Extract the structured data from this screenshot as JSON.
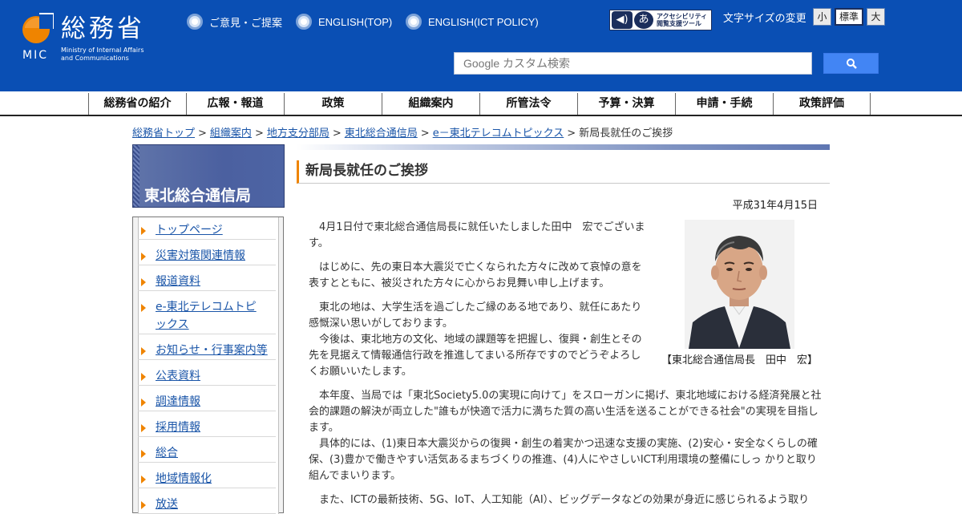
{
  "header": {
    "logo_text": "総務省",
    "logo_abbr": "MIC",
    "logo_en_line1": "Ministry of Internal Affairs",
    "logo_en_line2": "and Communications",
    "links": [
      "ご意見・ご提案",
      "ENGLISH(TOP)",
      "ENGLISH(ICT POLICY)"
    ],
    "a11y_tool_line1": "アクセシビリティ",
    "a11y_tool_line2": "閲覧支援ツール",
    "a11y_icon_char": "あ",
    "font_size_label": "文字サイズの変更",
    "font_size_options": [
      "小",
      "標準",
      "大"
    ],
    "search_placeholder": "Google カスタム検索"
  },
  "nav": [
    "総務省の紹介",
    "広報・報道",
    "政策",
    "組織案内",
    "所管法令",
    "予算・決算",
    "申請・手続",
    "政策評価"
  ],
  "breadcrumb": {
    "links": [
      "総務省トップ",
      "組織案内",
      "地方支分部局",
      "東北総合通信局",
      "e－東北テレコムトピックス"
    ],
    "current": "新局長就任のご挨拶",
    "sep": ">"
  },
  "sidebar": {
    "title": "東北総合通信局",
    "items": [
      "トップページ",
      "災害対策関連情報",
      "報道資料",
      "e-東北テレコムトピ",
      "ックス",
      "お知らせ・行事案内等",
      "公表資料",
      "調達情報",
      "採用情報",
      "総合",
      "地域情報化",
      "放送"
    ]
  },
  "main": {
    "title": "新局長就任のご挨拶",
    "date": "平成31年4月15日",
    "p1_l1": "　4月1日付で東北総合通信局長に就任いたしました田中　宏でございま",
    "p1_l2": "す。",
    "p2_l1": "　はじめに、先の東日本大震災で亡くなられた方々に改めて哀悼の意を",
    "p2_l2": "表すとともに、被災された方々に心からお見舞い申し上げます。",
    "p3_l1": "　東北の地は、大学生活を過ごしたご縁のある地であり、就任にあたり",
    "p3_l2": "感慨深い思いがしております。",
    "p3_l3": "　今後は、東北地方の文化、地域の課題等を把握し、復興・創生とその",
    "p3_l4": "先を見据えて情報通信行政を推進してまいる所存ですのでどうぞよろし",
    "p3_l5": "くお願いいたします。",
    "p4_l1": "　本年度、当局では「東北Society5.0の実現に向けて」をスローガンに掲げ、東北地域における経済発展と社",
    "p4_l2": "会的課題の解決が両立した\"誰もが快適で活力に満ちた質の高い生活を送ることができる社会\"の実現を目指し",
    "p4_l3": "ます。",
    "p4_l4": "　具体的には、(1)東日本大震災からの復興・創生の着実かつ迅速な支援の実施、(2)安心・安全なくらしの確",
    "p4_l5": "保、(3)豊かで働きやすい活気あるまちづくりの推進、(4)人にやさしいICT利用環境の整備にしっ かりと取り",
    "p4_l6": "組んでまいります。",
    "p5_l1": "　また、ICTの最新技術、5G、IoT、人工知能（AI）、ビッグデータなどの効果が身近に感じられるよう取り",
    "photo_caption": "【東北総合通信局長　田中　宏】"
  },
  "colors": {
    "header_bg": "#0a4fb4",
    "accent": "#ef8400",
    "link": "#1a55a8"
  }
}
